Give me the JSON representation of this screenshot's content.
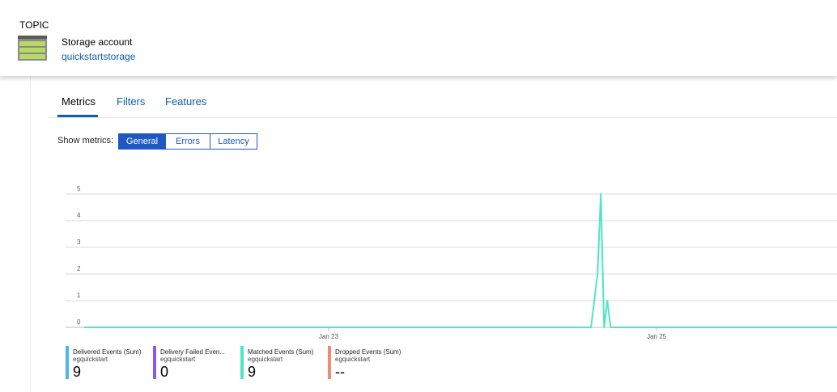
{
  "header": {
    "topic_label": "TOPIC",
    "resource_type": "Storage account",
    "resource_name": "quickstartstorage",
    "icon": "storage-account-icon"
  },
  "tabs": [
    {
      "label": "Metrics",
      "active": true
    },
    {
      "label": "Filters",
      "active": false
    },
    {
      "label": "Features",
      "active": false
    }
  ],
  "metrics_filter": {
    "label": "Show metrics:",
    "options": [
      "General",
      "Errors",
      "Latency"
    ],
    "selected": "General"
  },
  "colors": {
    "accent": "#1f58c4",
    "link": "#0a5fb4",
    "delivered": "#4db8e8",
    "delivery_failed": "#8a5be8",
    "matched": "#4ee5c8",
    "dropped": "#ee8e6e"
  },
  "legend": [
    {
      "name": "Delivered Events (Sum)",
      "sub": "egquickstart",
      "value": "9",
      "color": "#4db8e8"
    },
    {
      "name": "Delivery Failed Even...",
      "sub": "egquickstart",
      "value": "0",
      "color": "#8a5be8"
    },
    {
      "name": "Matched Events (Sum)",
      "sub": "egquickstart",
      "value": "9",
      "color": "#4ee5c8"
    },
    {
      "name": "Dropped Events (Sum)",
      "sub": "egquickstart",
      "value": "--",
      "color": "#ee8e6e"
    }
  ],
  "chart_data": {
    "type": "line",
    "title": "",
    "xlabel": "",
    "ylabel": "",
    "ylim": [
      0,
      5
    ],
    "y_ticks": [
      "0",
      "1",
      "2",
      "3",
      "4",
      "5"
    ],
    "x_ticks": [
      "Jan 23",
      "Jan 25"
    ],
    "x_tick_positions": [
      1,
      3
    ],
    "xlim": [
      -0.49,
      4.1
    ],
    "grid": true,
    "series": [
      {
        "color": "#4ee5c8",
        "x": [
          -0.49,
          2.6,
          2.64,
          2.66,
          2.68,
          2.7,
          2.72,
          2.74,
          4.1
        ],
        "values": [
          0,
          0,
          2,
          5,
          0,
          1,
          0,
          0,
          0
        ]
      }
    ]
  }
}
